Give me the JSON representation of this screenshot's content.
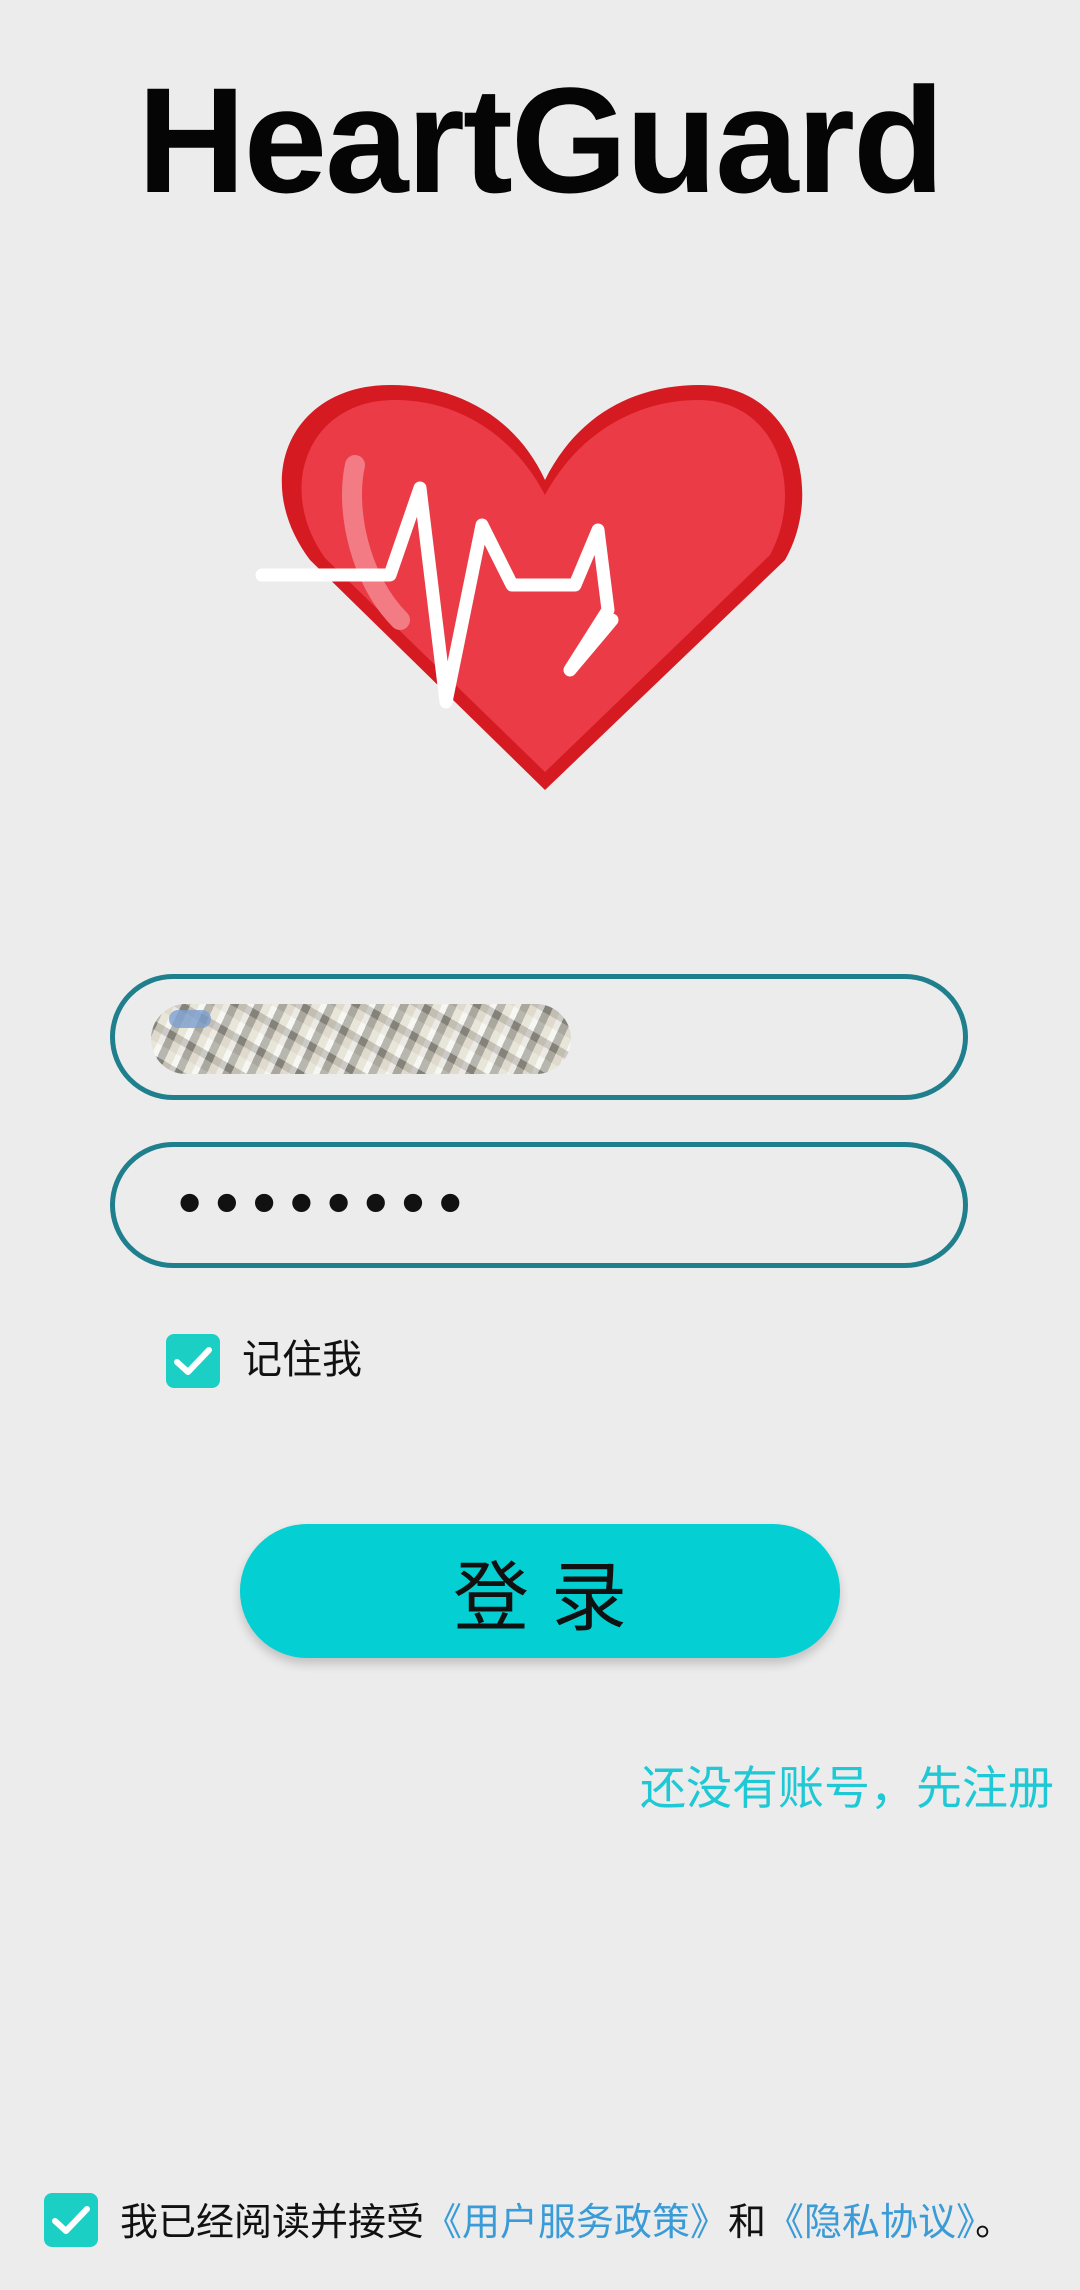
{
  "app": {
    "title": "HeartGuard"
  },
  "login_form": {
    "username_value": "",
    "password_value": "••••••••",
    "remember_me_label": "记住我",
    "remember_me_checked": true,
    "login_button_label": "登录",
    "register_link": "还没有账号，先注册"
  },
  "agreement": {
    "checked": true,
    "prefix": "我已经阅读并接受",
    "terms_link": "《用户服务政策》",
    "conjunction": "和",
    "privacy_link": "《隐私协议》",
    "suffix": "。"
  },
  "icons": {
    "logo": "heart-pulse-icon",
    "checkmark": "check-icon"
  },
  "colors": {
    "accent": "#04cfd2",
    "field_border": "#1f7f8c",
    "checkbox": "#1ccfc5",
    "link": "#3a9bd6",
    "register_link": "#1ec8d4",
    "heart": "#e93b48"
  }
}
